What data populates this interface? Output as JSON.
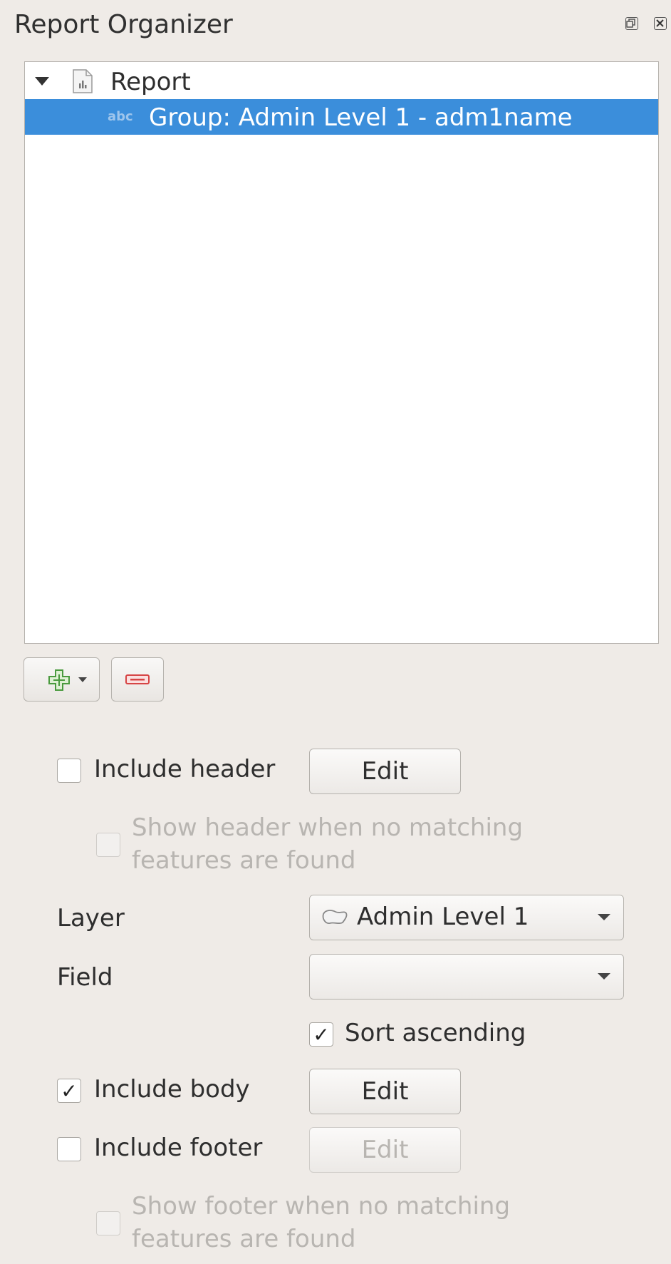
{
  "panel": {
    "title": "Report Organizer"
  },
  "tree": {
    "root_label": "Report",
    "child_label": "Group: Admin Level 1 - adm1name",
    "child_badge": "abc"
  },
  "toolbar": {
    "add_icon": "add-plus-icon",
    "remove_icon": "remove-minus-icon"
  },
  "options": {
    "include_header_label": "Include header",
    "include_header_checked": false,
    "header_edit_label": "Edit",
    "show_header_line1": "Show header when no matching",
    "show_header_line2": "features are found",
    "layer_label": "Layer",
    "layer_value": "Admin Level 1",
    "field_label": "Field",
    "field_value": "",
    "sort_ascending_label": "Sort ascending",
    "sort_ascending_mark": "✓",
    "include_body_label": "Include body",
    "include_body_mark": "✓",
    "body_edit_label": "Edit",
    "include_footer_label": "Include footer",
    "include_footer_checked": false,
    "footer_edit_label": "Edit",
    "show_footer_line1": "Show footer when no matching",
    "show_footer_line2": "features are found"
  },
  "colors": {
    "selection": "#3b8edb",
    "add_green": "#4a9a3e",
    "remove_red": "#d64545"
  }
}
